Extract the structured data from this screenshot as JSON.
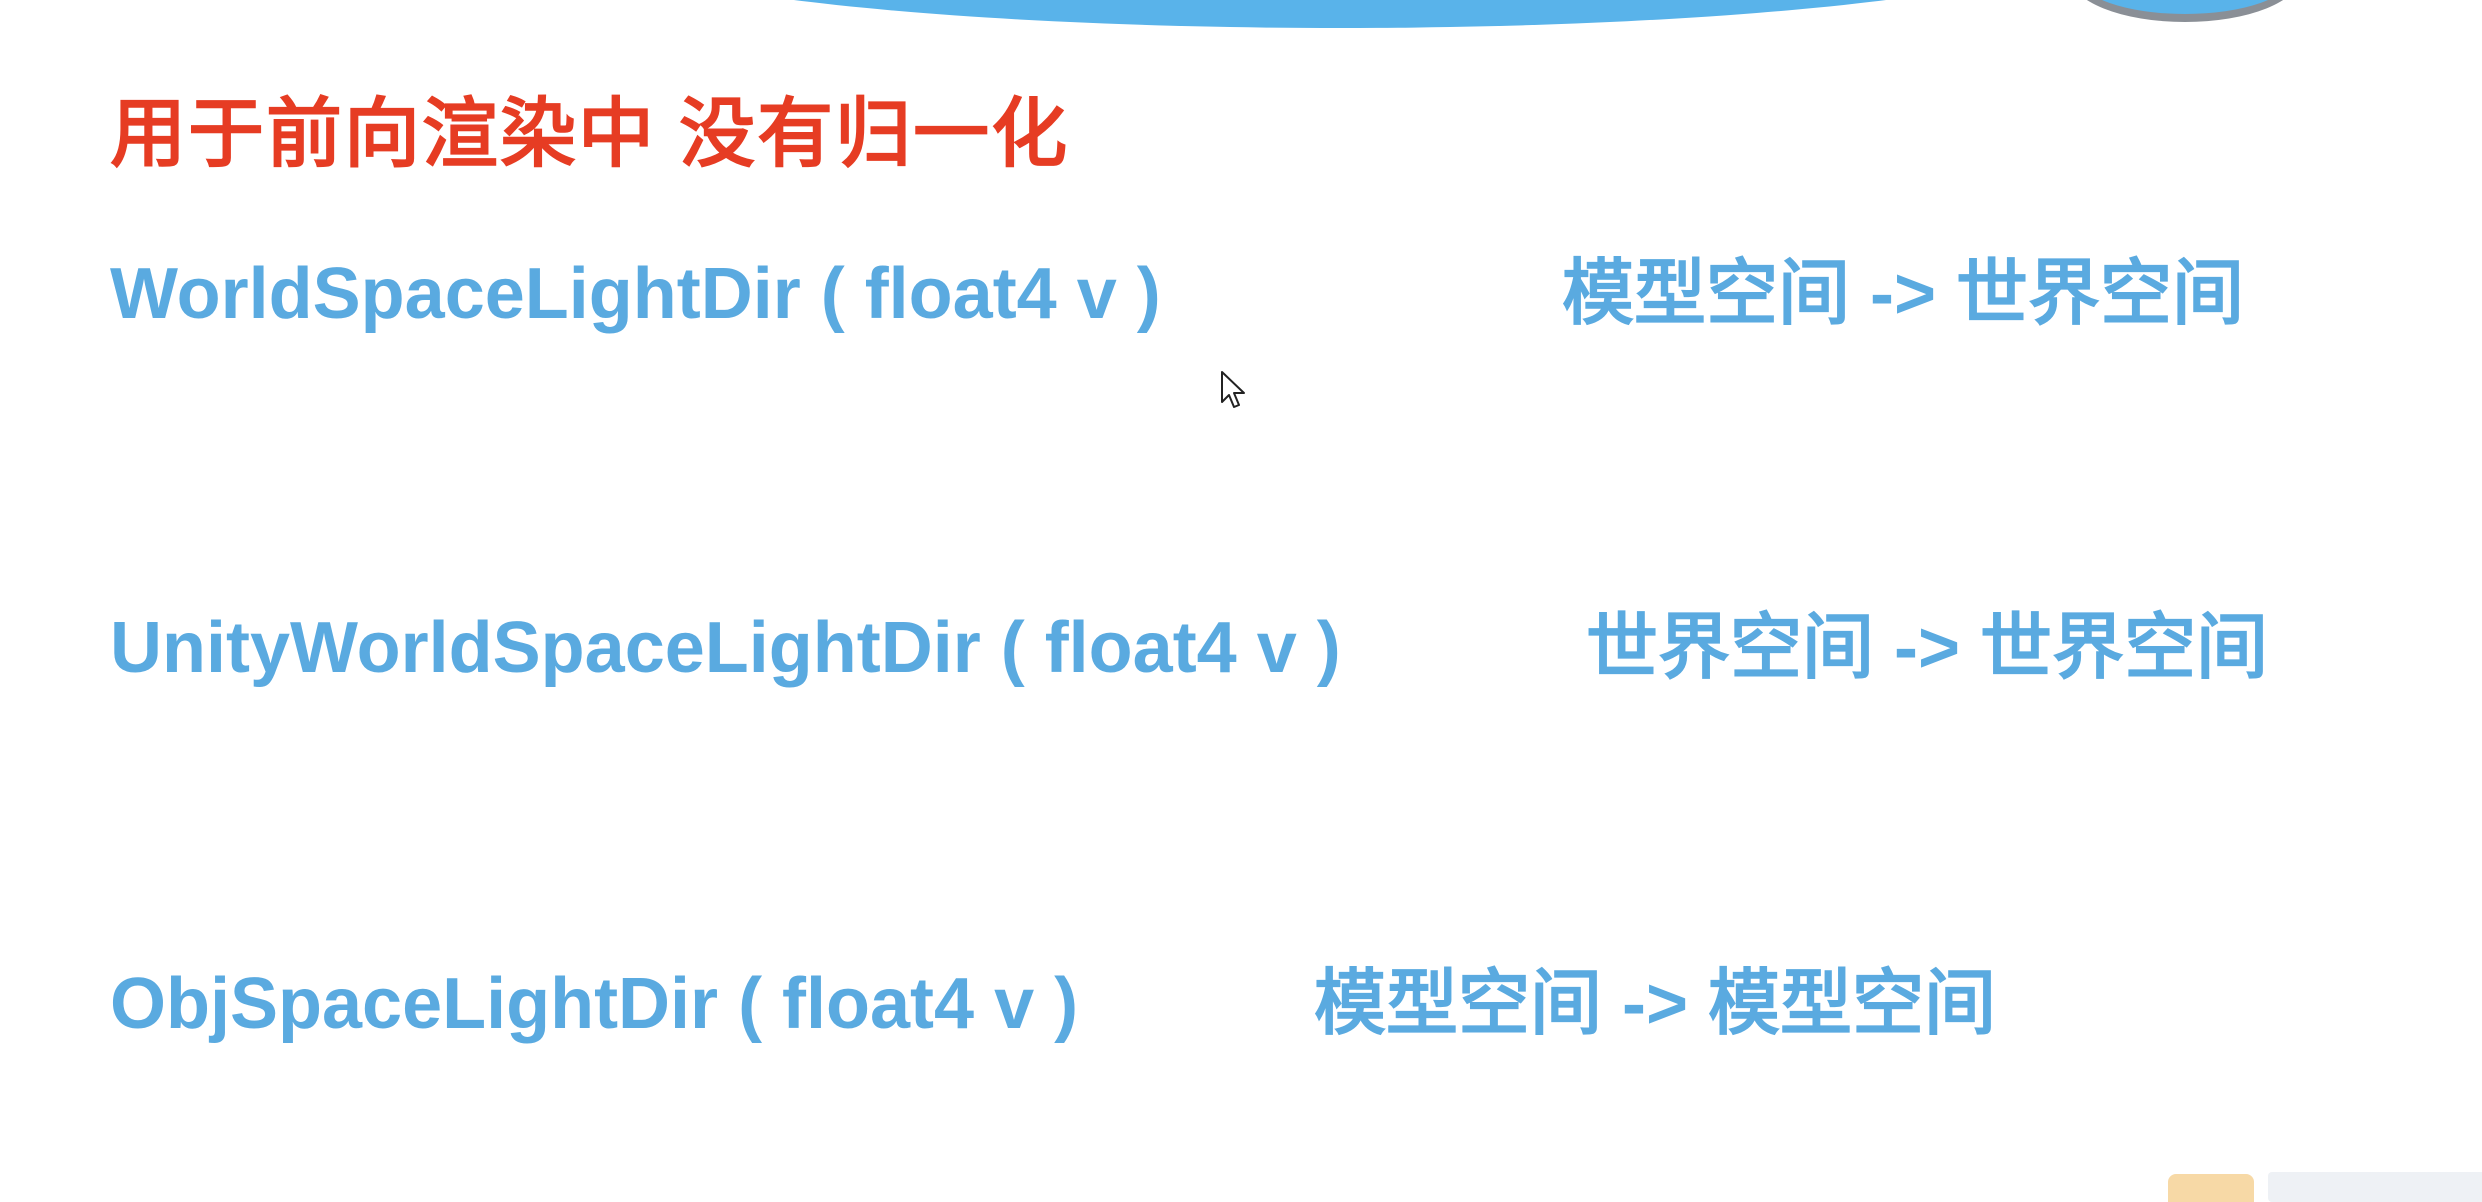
{
  "slide": {
    "headline": "用于前向渲染中 没有归一化",
    "functions": [
      {
        "signature": "WorldSpaceLightDir ( float4 v )",
        "conversion": "模型空间 -> 世界空间"
      },
      {
        "signature": "UnityWorldSpaceLightDir ( float4 v )",
        "conversion": "世界空间 -> 世界空间"
      },
      {
        "signature": "ObjSpaceLightDir ( float4 v )",
        "conversion": "模型空间 -> 模型空间"
      }
    ]
  },
  "colors": {
    "headline": "#e63c23",
    "body_text": "#5aaae0",
    "banner": "#59b3ea",
    "background": "#ffffff"
  },
  "icons": {
    "cursor": "mouse-pointer-icon",
    "watermark": "video-logo-icon"
  }
}
